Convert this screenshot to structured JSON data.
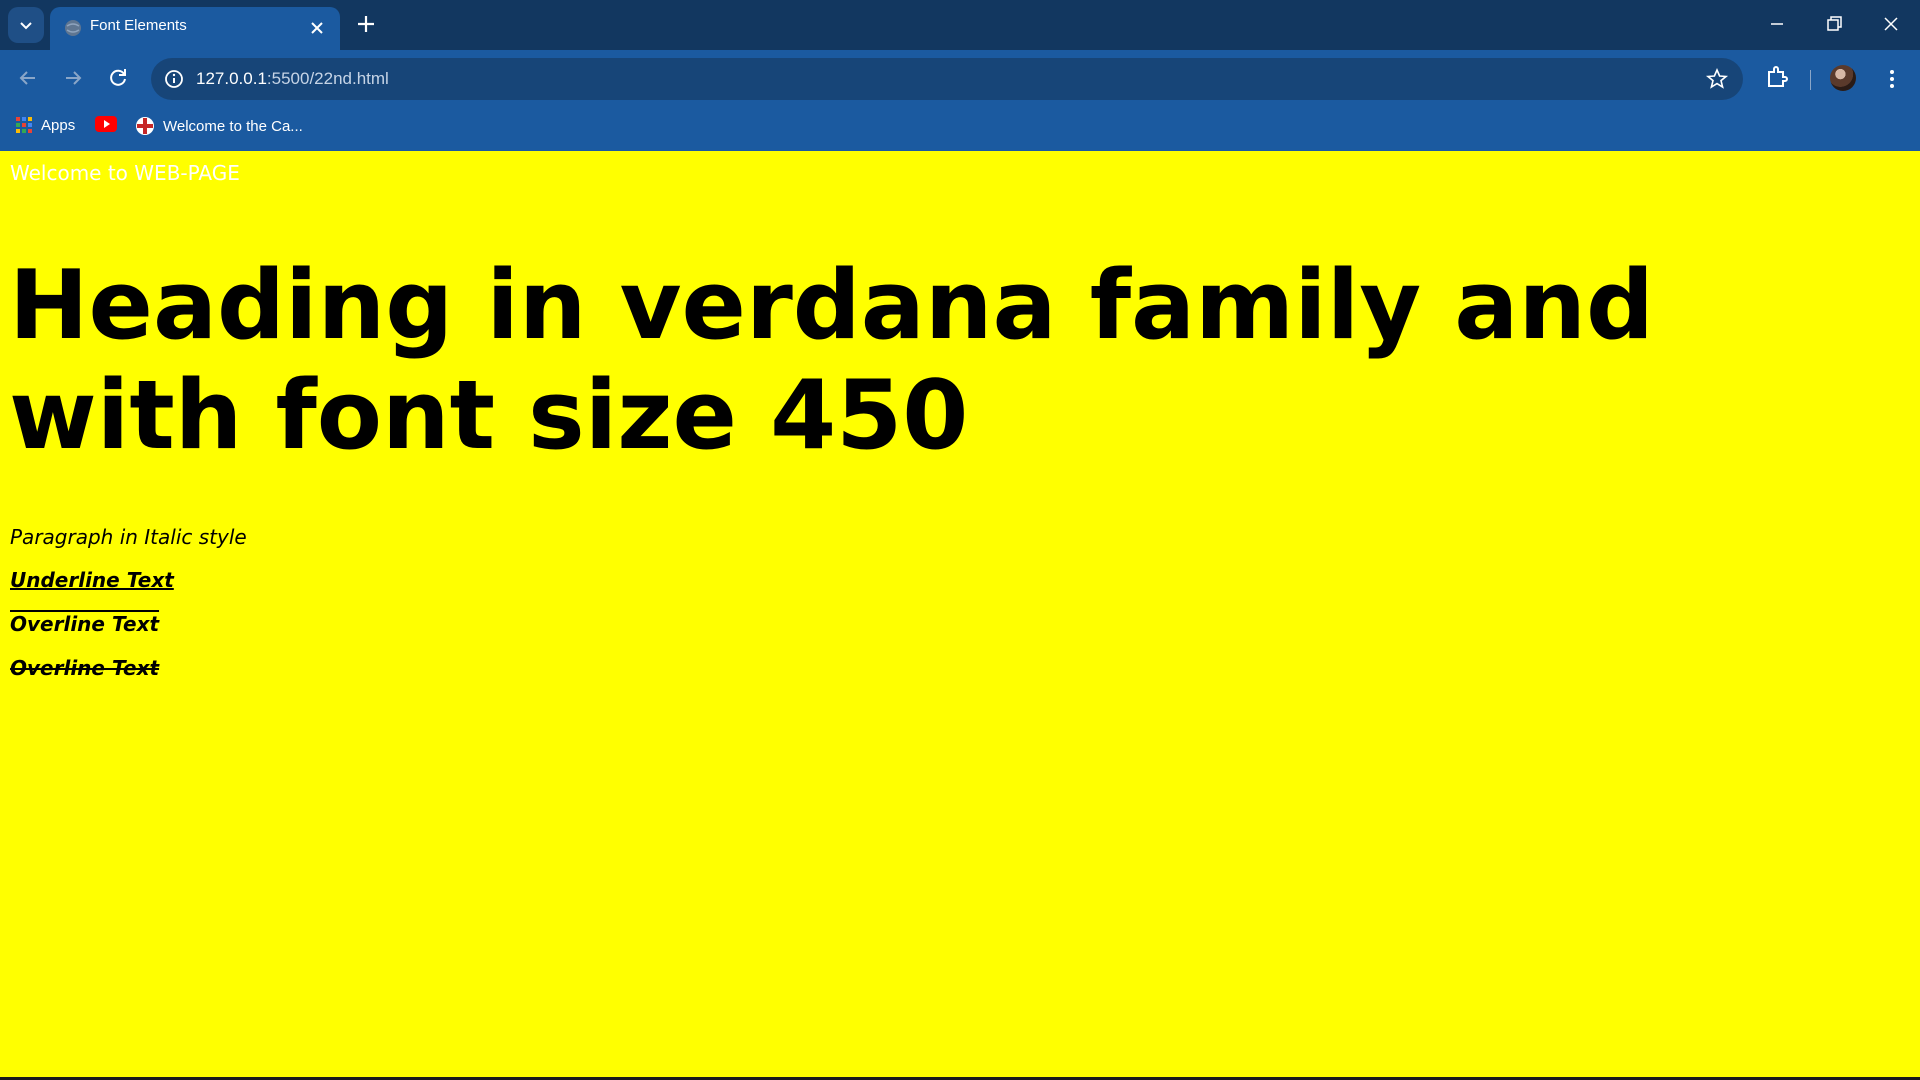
{
  "browser": {
    "tab": {
      "title": "Font Elements"
    },
    "address_bar": {
      "host": "127.0.0.1",
      "rest": ":5500/22nd.html"
    },
    "bookmarks": [
      {
        "label": "Apps",
        "icon": "apps-grid-icon"
      },
      {
        "label": "",
        "icon": "youtube-icon"
      },
      {
        "label": "Welcome to the Ca...",
        "icon": "site-favicon-icon"
      }
    ]
  },
  "page": {
    "welcome_text": "Welcome to WEB-PAGE",
    "heading": "Heading in verdana family and with font size 450",
    "italic_paragraph": "Paragraph in Italic style",
    "underline_text": "Underline Text",
    "overline_text": "Overline Text",
    "linethrough_text": "Overline Text",
    "background_color": "#ffff00"
  }
}
